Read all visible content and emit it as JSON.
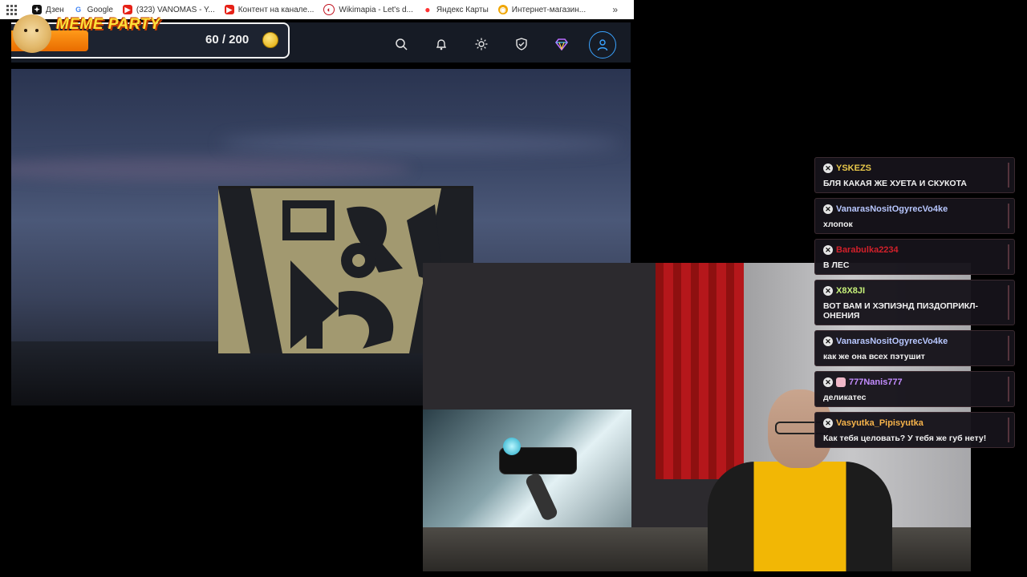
{
  "bookmarks": [
    {
      "label": "Дзен",
      "icon": "dzen-icon",
      "color": "#111111"
    },
    {
      "label": "Google",
      "icon": "google-icon",
      "color": "#4285f4"
    },
    {
      "label": "(323) VANOMAS - Y...",
      "icon": "youtube-icon",
      "color": "#e62117"
    },
    {
      "label": "Контент на канале...",
      "icon": "youtube-icon",
      "color": "#e62117"
    },
    {
      "label": "Wikimapia - Let's d...",
      "icon": "wikimapia-icon",
      "color": "#c1121f"
    },
    {
      "label": "Яндекс Карты",
      "icon": "yandex-maps-pin-icon",
      "color": "#ff3333"
    },
    {
      "label": "Интернет-магазин...",
      "icon": "shop-icon",
      "color": "#f0a500"
    }
  ],
  "bookmarks_more": "»",
  "header": {
    "title": "MEME PARTY",
    "count": "60 / 200",
    "progress": 0.3,
    "icons": [
      "search-icon",
      "bell-icon",
      "sun-icon",
      "shield-check-icon",
      "diamond-icon",
      "profile-icon"
    ]
  },
  "chat": [
    {
      "user": "YSKEZS",
      "color": "#e8c84a",
      "badge": "",
      "text": "БЛЯ КАКАЯ ЖЕ ХУЕТА И СКУКОТА"
    },
    {
      "user": "VanarasNositOgyrecVo4ke",
      "color": "#b8c7ff",
      "badge": "",
      "text": "хлопок"
    },
    {
      "user": "Barabulka2234",
      "color": "#d2202a",
      "badge": "",
      "text": "В ЛЕС"
    },
    {
      "user": "X8X8JI",
      "color": "#c7f27a",
      "badge": "",
      "text": "ВОТ ВАМ И ХЭПИЭНД ПИЗДОПРИКЛ-ОНЕНИЯ"
    },
    {
      "user": "VanarasNositOgyrecVo4ke",
      "color": "#b8c7ff",
      "badge": "",
      "text": "как же она всех пэтушит"
    },
    {
      "user": "777Nanis777",
      "color": "#c38cff",
      "badge": "pig",
      "text": "деликатес"
    },
    {
      "user": "Vasyutka_Pipisyutka",
      "color": "#f6b34a",
      "badge": "",
      "text": "Как тебя целовать? У тебя же губ нету!"
    }
  ]
}
